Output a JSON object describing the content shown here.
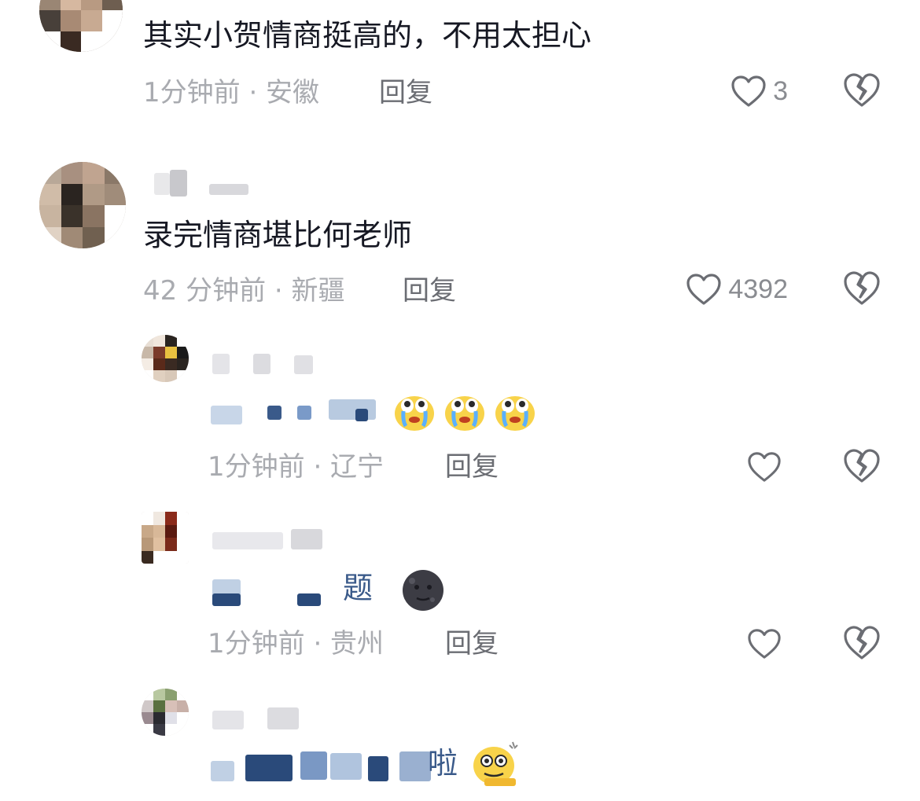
{
  "comments": [
    {
      "text": "其实小贺情商挺高的，不用太担心",
      "meta": "1分钟前 · 安徽",
      "reply_label": "回复",
      "likes": "3"
    },
    {
      "text": "录完情商堪比何老师",
      "meta": "42 分钟前 · 新疆",
      "reply_label": "回复",
      "likes": "4392"
    },
    {
      "meta": "1分钟前 · 辽宁",
      "reply_label": "回复",
      "likes": "",
      "emojis": [
        "crying-face-emoji",
        "crying-face-emoji",
        "crying-face-emoji"
      ]
    },
    {
      "text_visible": "题",
      "meta": "1分钟前 · 贵州",
      "reply_label": "回复",
      "likes": "",
      "emojis": [
        "dark-moon-face-emoji"
      ]
    },
    {
      "text_visible": "啦",
      "emojis": [
        "dizzy-face-emoji"
      ]
    }
  ],
  "colors": {
    "text": "#161823",
    "meta": "#a9abb0",
    "reply": "#6b6d73",
    "icon": "#6b6d73",
    "blur_blue": "#2a5a9a"
  }
}
